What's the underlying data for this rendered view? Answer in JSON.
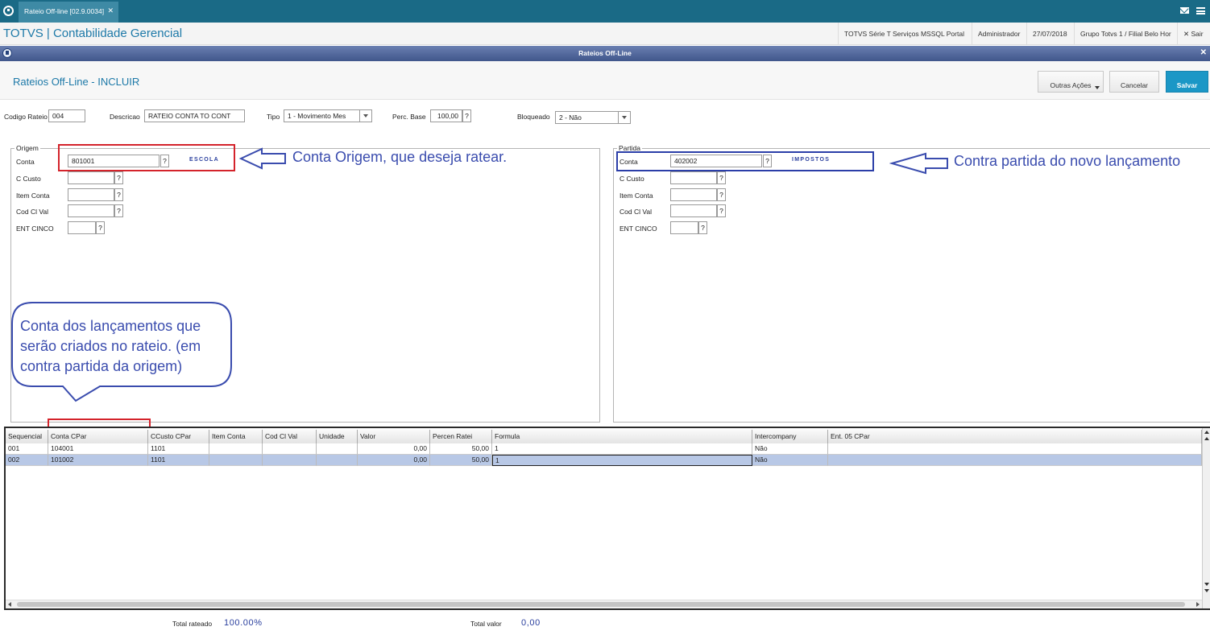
{
  "tab": {
    "title": "Rateio Off-line [02.9.0034]",
    "close": "✕"
  },
  "header": {
    "brand": "TOTVS | Contabilidade Gerencial",
    "environment": "TOTVS Série T Serviços MSSQL Portal",
    "user": "Administrador",
    "date": "27/07/2018",
    "branch": "Grupo Totvs 1 / Filial Belo Hor",
    "exit": "✕ Sair"
  },
  "window": {
    "title": "Rateios Off-Line",
    "close": "✕"
  },
  "page": {
    "title": "Rateios Off-Line - INCLUIR"
  },
  "toolbar": {
    "other_actions": "Outras Ações",
    "cancel": "Cancelar",
    "save": "Salvar"
  },
  "form": {
    "codigo_label": "Codigo Rateio",
    "codigo_value": "004",
    "descricao_label": "Descricao",
    "descricao_value": "RATEIO CONTA TO CONT",
    "tipo_label": "Tipo",
    "tipo_value": "1 - Movimento Mes",
    "perc_label": "Perc. Base",
    "perc_value": "100,00",
    "bloqueado_label": "Bloqueado",
    "bloqueado_value": "2 - Não",
    "help": "?"
  },
  "origem": {
    "title": "Origem",
    "conta_label": "Conta",
    "conta_value": "801001",
    "conta_desc": "ESCOLA",
    "ccusto_label": "C Custo",
    "item_label": "Item Conta",
    "codcl_label": "Cod Cl Val",
    "ent_label": "ENT CINCO"
  },
  "partida": {
    "title": "Partida",
    "conta_label": "Conta",
    "conta_value": "402002",
    "conta_desc": "IMPOSTOS",
    "ccusto_label": "C Custo",
    "item_label": "Item Conta",
    "codcl_label": "Cod Cl Val",
    "ent_label": "ENT CINCO"
  },
  "annotations": {
    "origem": "Conta Origem, que deseja ratear.",
    "partida": "Contra partida do novo lançamento",
    "callout_line1": "Conta dos lançamentos que",
    "callout_line2": "serão criados no rateio. (em",
    "callout_line3": "contra partida da origem)"
  },
  "grid": {
    "columns": [
      "Sequencial",
      "Conta CPar",
      "CCusto CPar",
      "Item Conta",
      "Cod Cl Val",
      "Unidade",
      "Valor",
      "Percen Ratei",
      "Formula",
      "Intercompany",
      "Ent. 05 CPar"
    ],
    "rows": [
      [
        "001",
        "104001",
        "1101",
        "",
        "",
        "",
        "0,00",
        "50,00",
        "1",
        "Não",
        ""
      ],
      [
        "002",
        "101002",
        "1101",
        "",
        "",
        "",
        "0,00",
        "50,00",
        "1",
        "Não",
        ""
      ]
    ]
  },
  "totals": {
    "rateado_label": "Total rateado",
    "rateado_value": "100.00%",
    "valor_label": "Total valor",
    "valor_value": "0,00"
  },
  "colors": {
    "brand": "#1d79a8",
    "save": "#1b97c6",
    "annotation_blue": "#3a4cae",
    "annotation_red": "#d4232b",
    "selected_row": "#b8c8e6"
  }
}
